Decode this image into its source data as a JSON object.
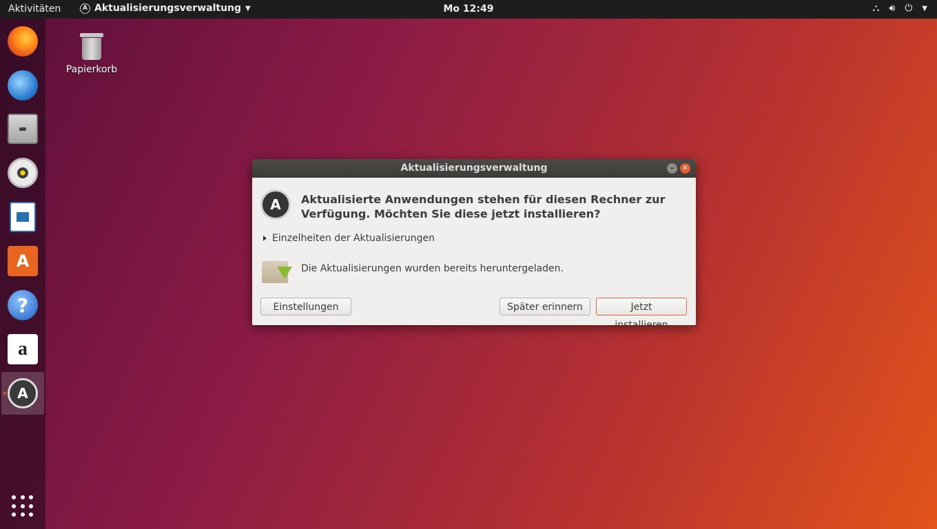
{
  "topbar": {
    "activities": "Aktivitäten",
    "app_menu": "Aktualisierungsverwaltung",
    "clock": "Mo 12:49"
  },
  "dock": {
    "items": [
      {
        "name": "Firefox",
        "icon": "firefox-icon"
      },
      {
        "name": "Thunderbird",
        "icon": "thunderbird-icon"
      },
      {
        "name": "Dateien",
        "icon": "files-icon"
      },
      {
        "name": "Rhythmbox",
        "icon": "rhythmbox-icon"
      },
      {
        "name": "LibreOffice Writer",
        "icon": "writer-icon"
      },
      {
        "name": "Ubuntu Software",
        "icon": "software-icon"
      },
      {
        "name": "Hilfe",
        "icon": "help-icon"
      },
      {
        "name": "Amazon",
        "icon": "amazon-icon"
      },
      {
        "name": "Aktualisierungsverwaltung",
        "icon": "update-manager-icon",
        "active": true
      }
    ]
  },
  "desktop": {
    "trash_label": "Papierkorb"
  },
  "dialog": {
    "title": "Aktualisierungsverwaltung",
    "headline": "Aktualisierte Anwendungen stehen für diesen Rechner zur Verfügung. Möchten Sie diese jetzt installieren?",
    "expander": "Einzelheiten der Aktualisierungen",
    "status": "Die Aktualisierungen wurden bereits heruntergeladen.",
    "buttons": {
      "settings": "Einstellungen …",
      "later": "Später erinnern",
      "install": "Jetzt installieren"
    }
  },
  "colors": {
    "accent": "#e95420",
    "topbar": "#1d1d1d",
    "dialog_bg": "#f0efed"
  }
}
